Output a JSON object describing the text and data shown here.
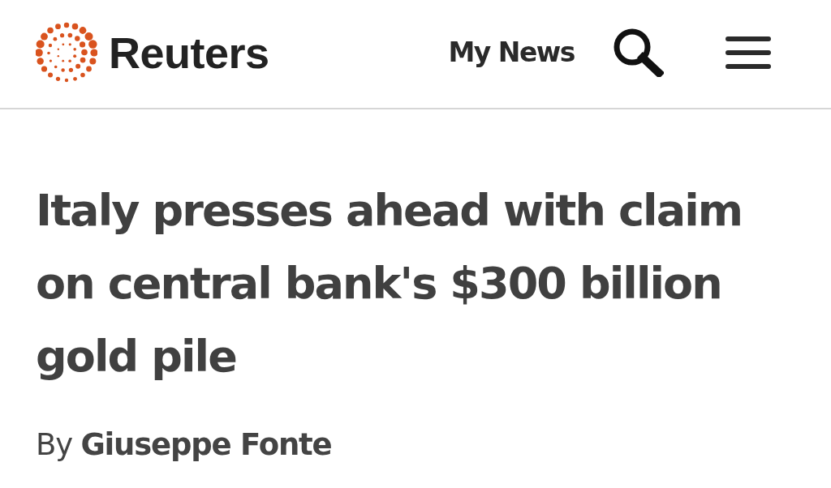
{
  "header": {
    "logo": {
      "wordmark": "Reuters"
    },
    "nav_link": "My News"
  },
  "article": {
    "headline": "Italy presses ahead with claim on central bank's $300 billion gold pile",
    "byline": "By **Giuseppe Fonte**"
  }
}
